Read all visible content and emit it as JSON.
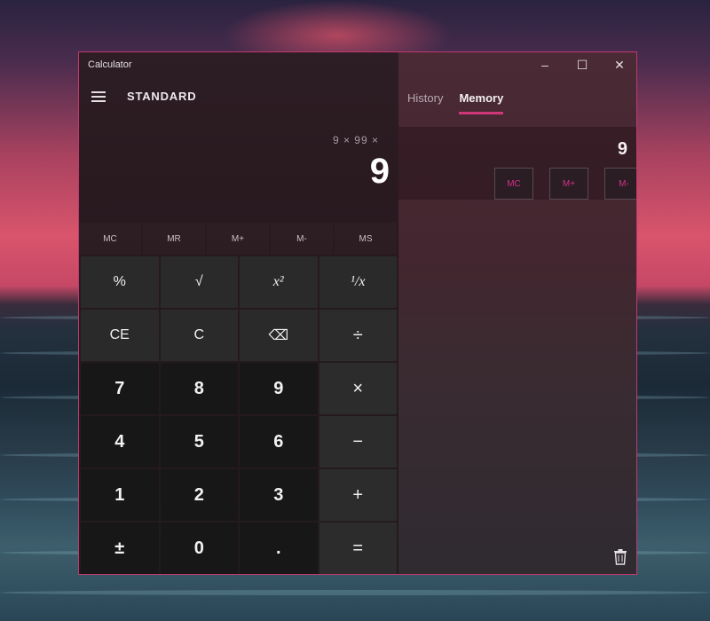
{
  "window": {
    "title": "Calculator",
    "controls": {
      "minimize": "–",
      "maximize": "☐",
      "close": "✕"
    }
  },
  "calculator": {
    "mode": "STANDARD",
    "expression": "9 × 99 ×",
    "result": "9"
  },
  "memory_row": [
    "MC",
    "MR",
    "M+",
    "M-",
    "MS"
  ],
  "keys": [
    [
      "%",
      "√",
      "x²",
      "¹/x"
    ],
    [
      "CE",
      "C",
      "⌫",
      "÷"
    ],
    [
      "7",
      "8",
      "9",
      "×"
    ],
    [
      "4",
      "5",
      "6",
      "−"
    ],
    [
      "1",
      "2",
      "3",
      "+"
    ],
    [
      "±",
      "0",
      ".",
      "="
    ]
  ],
  "side_panel": {
    "tabs": [
      "History",
      "Memory"
    ],
    "active_tab": "Memory",
    "memory_value": "9",
    "item_buttons": [
      "MC",
      "M+",
      "M-"
    ]
  },
  "colors": {
    "accent": "#d0377b",
    "window_border": "#c2386f"
  }
}
